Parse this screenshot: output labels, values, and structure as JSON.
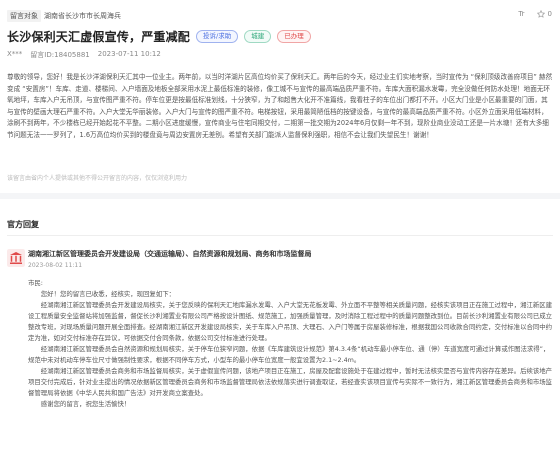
{
  "meta": {
    "tag": "留言对象",
    "object": "湖南省长沙市市长周海兵",
    "font_icon": "Tr",
    "like_count": "0"
  },
  "title": "长沙保利天汇虚假宣传，严重减配",
  "badges": [
    "投诉/求助",
    "城建",
    "已办理"
  ],
  "author": {
    "name": "X***",
    "id": "留言ID:18405881",
    "time": "2023-07-11 10:12"
  },
  "content": "尊敬的领导，您好！我是长沙洋湖保利天汇其中一位业主。两年前，以当时洋湖片区高位均价买了保利天汇。两年后的今天，经过业主们实地考察，当时宣传为 “保利顶级改善府项目” 赫然变成 “安置房”！车库、走道、楼梯间、入户墙面及地板全部采用水泥上最低标准的装修，像工城不与宣传的最高端品质严重不符。车库大面积漏水发霉，完全没做任何防水处理！地面无环氧地坪，车库入户无吊顶，与宣传图严重不符。停车位更是按最低标准划线，十分狭窄，为了和超售大化开不准篇线，我看柱子的车位出门都打不开。小区大门业是小区最重要的门面，其与宣传的壁画大理石严重不符。入户大堂无华丽装修。入户大门与宣传的图严重不符。电梯按钮，采用最简陋低档的按键设备，与宣传的最高端品质严重不符。小区外立面采用低端材料，涂刷不到两年，不少楼栋已经开始起花不平整。二期小区进度缓慢，宣传商业与住宅同期交付，二期第一批交期为2024年6月仅剩一年不到，现阶业商业没动工还是一片水塘！还有大多细节问题无法一一罗列了，1.6万高位均价买到的楼盘竟与周边安置房无差别。希望有关部门能派人监督保利强职，相信不会让我们失望民生！谢谢！",
  "hint": "该留言由省内个人提供或其他不得公开留言的内容，仅仅浏览利用力",
  "section_title": "官方回复",
  "reply": {
    "org": "湖南湘江新区管理委员会开发建设局（交通运输局）、自然资源和规划局、商务和市场监督局",
    "date": "2023-08-02 11:11",
    "greeting": "市民:",
    "paragraphs": [
      "您好！您的留言已收悉，经核实，现回复如下：",
      "经湖南湘江新区管理委员会开发建设局核实，关于您反映的保利天汇地库漏水发霉、入户大堂无花板发霉、外立面不平整等相关质量问题，经核实该项目正在施工过程中，湘江新区建设工程质量安全监督站将加强监督，督促长沙利湘置业有限公司严格按设计图纸、规范施工，加强质量管理，及时消除工程过程中的质量问题整改到位。目前长沙利湘置业有限公司已成立整改专班，对现场质量问题开展全面排查。经湖南湘江新区开发建设局核实，关于车库入户吊顶、大理石、入户门等属于房屋装修标准，根据我国公司收款合同约定，交付标准以合同中约定为准，如对交付标准存在异议，可依据交付合同条款，依据公司交付标准进行处理。",
      "经湖南湘江新区管理委员会自然资源和规划局核实，关于停车位狭窄问题，依据《车库建筑设计规范》第4.3.4条“机动车最小停车位、通（停）车道宽度可通过计算或作图法求得”，规范中未对机动车停车位尺寸做强制性要求，根据不同停车方式，小型车的最小停车位宽度一般宜设置为2.1~2.4m。",
      "经湖南湘江新区管理委员会商务和市场监督局核实，关于虚假宣传问题，该地产项目正在施工，房屋及配套设施处于在建过程中，暂时无法核实是否与宣传内容存在差异。后续该地产项目交付完成后，针对业主提出的情况依据新区管理委员会商务和市场监督管理局依法依规落实进行调查取证，若经查实该项目宣传与实际不一致行为，湘江新区管理委员会商务和市场监督管理局将依据《中华人民共和国广告法》对开发商立案查处。",
      "感谢您的留言，祝您生活愉快！"
    ]
  },
  "colors": {
    "accent_blue": "#4a6ee0",
    "accent_green": "#2fa87a",
    "accent_red": "#e04a4a"
  }
}
